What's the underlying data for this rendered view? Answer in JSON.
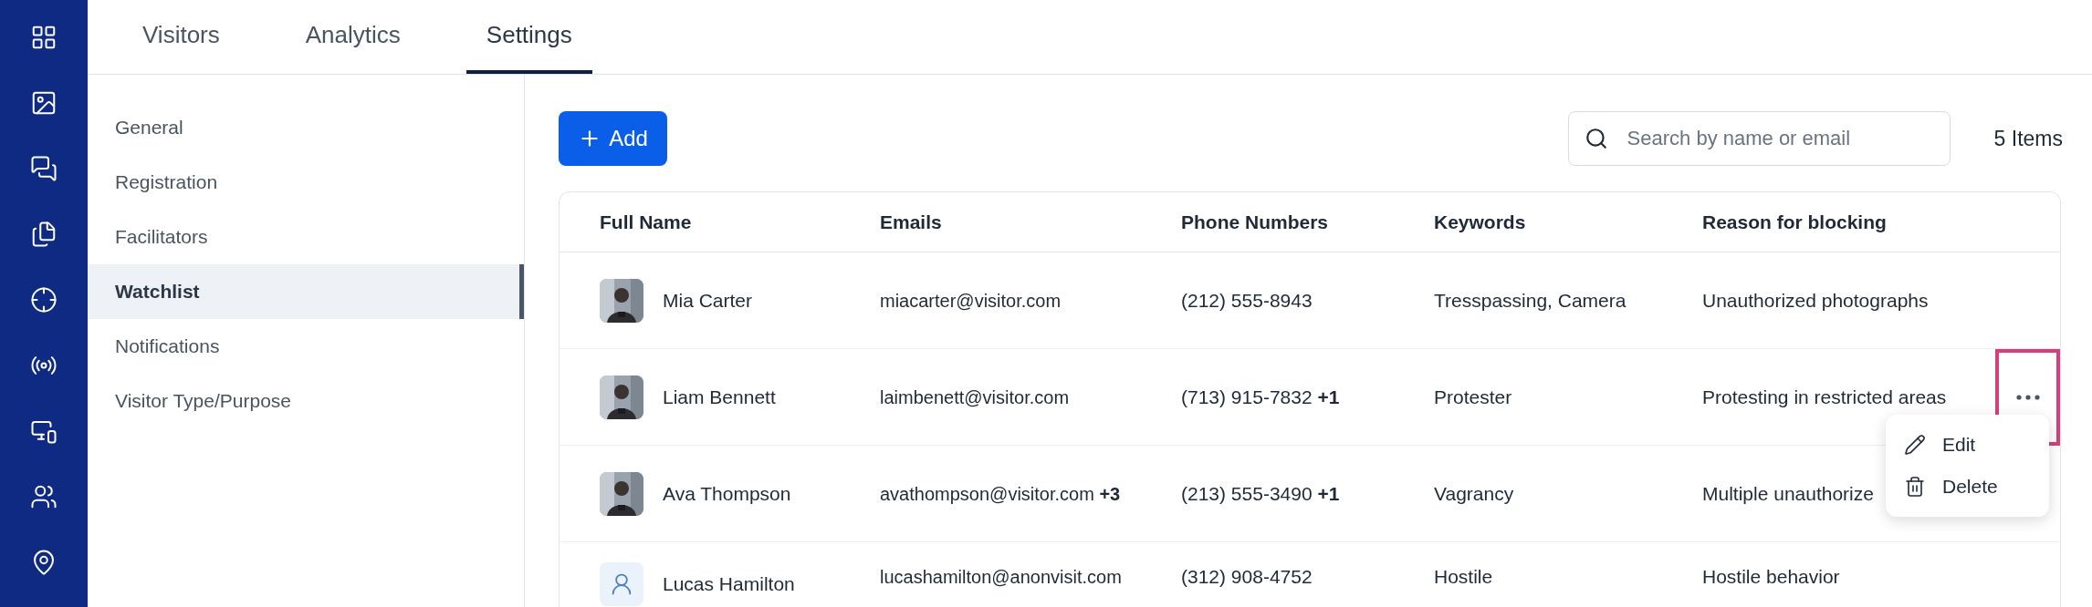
{
  "tabs": [
    {
      "label": "Visitors",
      "selected": false
    },
    {
      "label": "Analytics",
      "selected": false
    },
    {
      "label": "Settings",
      "selected": true
    }
  ],
  "settings_menu": [
    {
      "label": "General",
      "selected": false
    },
    {
      "label": "Registration",
      "selected": false
    },
    {
      "label": "Facilitators",
      "selected": false
    },
    {
      "label": "Watchlist",
      "selected": true
    },
    {
      "label": "Notifications",
      "selected": false
    },
    {
      "label": "Visitor Type/Purpose",
      "selected": false
    }
  ],
  "toolbar": {
    "add_button": "Add",
    "search": {
      "placeholder": "Search by name or email"
    },
    "count": "5 Items"
  },
  "table": {
    "columns": [
      "Full Name",
      "Emails",
      "Phone Numbers",
      "Keywords",
      "Reason for blocking"
    ],
    "rows": [
      {
        "name": "Mia Carter",
        "email": "miacarter@visitor.com",
        "phone": "(212) 555-8943",
        "keywords": "Tresspassing, Camera",
        "reason": "Unauthorized photographs",
        "actions_open": false
      },
      {
        "name": "Liam Bennett",
        "email": "laimbenett@visitor.com",
        "phone": "(713) 915-7832 **+1**",
        "keywords": "Protester",
        "reason": "Protesting in restricted areas",
        "actions_open": true
      },
      {
        "name": "Ava Thompson",
        "email": "avathompson@visitor.com **+3**",
        "phone": "(213) 555-3490 **+1**",
        "keywords": "Vagrancy",
        "reason": "Multiple unauthorize",
        "actions_open": false
      },
      {
        "kind": "placeholder",
        "name": "Lucas Hamilton",
        "email": "lucashamilton@anonvisit.com",
        "phone": "(312) 908-4752",
        "keywords": "Hostile",
        "reason": "Hostile behavior",
        "actions_open": false
      }
    ]
  },
  "row_menu": [
    {
      "kind": "edit",
      "label": "Edit"
    },
    {
      "kind": "delete",
      "label": "Delete"
    }
  ]
}
